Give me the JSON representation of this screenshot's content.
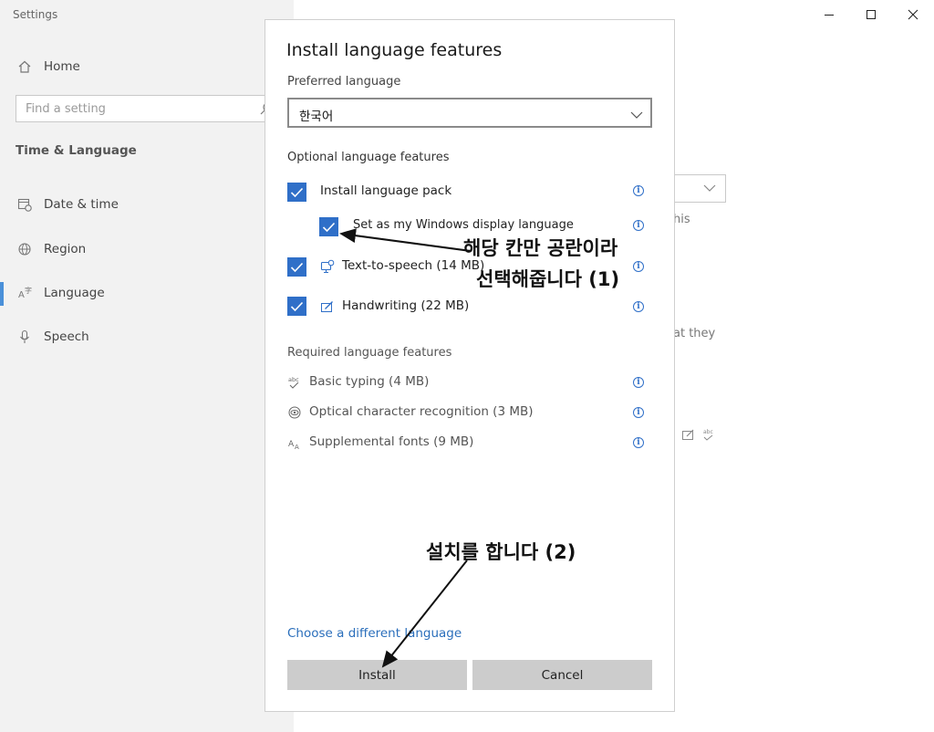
{
  "app": {
    "title": "Settings"
  },
  "sidebar": {
    "home_label": "Home",
    "search_placeholder": "Find a setting",
    "section_title": "Time & Language",
    "items": [
      {
        "label": "Date & time",
        "icon": "calendar-clock-icon"
      },
      {
        "label": "Region",
        "icon": "globe-icon"
      },
      {
        "label": "Language",
        "icon": "language-icon",
        "active": true
      },
      {
        "label": "Speech",
        "icon": "microphone-icon"
      }
    ]
  },
  "background": {
    "text_his": "his",
    "text_at_they": "at they"
  },
  "dialog": {
    "title": "Install language features",
    "preferred_label": "Preferred language",
    "preferred_value": "한국어",
    "optional_label": "Optional language features",
    "optional_items": [
      {
        "label": "Install language pack",
        "checked": true
      },
      {
        "label": "Set as my Windows display language",
        "checked": true
      },
      {
        "label": "Text-to-speech (14 MB)",
        "checked": true,
        "icon": "speech-bubble-monitor-icon"
      },
      {
        "label": "Handwriting (22 MB)",
        "checked": true,
        "icon": "pen-box-icon"
      }
    ],
    "required_label": "Required language features",
    "required_items": [
      {
        "label": "Basic typing (4 MB)",
        "icon": "abc-check-icon"
      },
      {
        "label": "Optical character recognition (3 MB)",
        "icon": "ocr-eye-icon"
      },
      {
        "label": "Supplemental fonts (9 MB)",
        "icon": "font-aa-icon"
      }
    ],
    "link_label": "Choose a different language",
    "install_label": "Install",
    "cancel_label": "Cancel"
  },
  "annotations": {
    "note1_line1": "해당 칸만 공란이라",
    "note1_line2": "선택해줍니다 (1)",
    "note2": "설치를 합니다 (2)"
  },
  "colors": {
    "accent": "#2f6fc8",
    "link": "#2a6ebb",
    "button": "#cccccc",
    "sidebar_bg": "#f2f2f2"
  }
}
